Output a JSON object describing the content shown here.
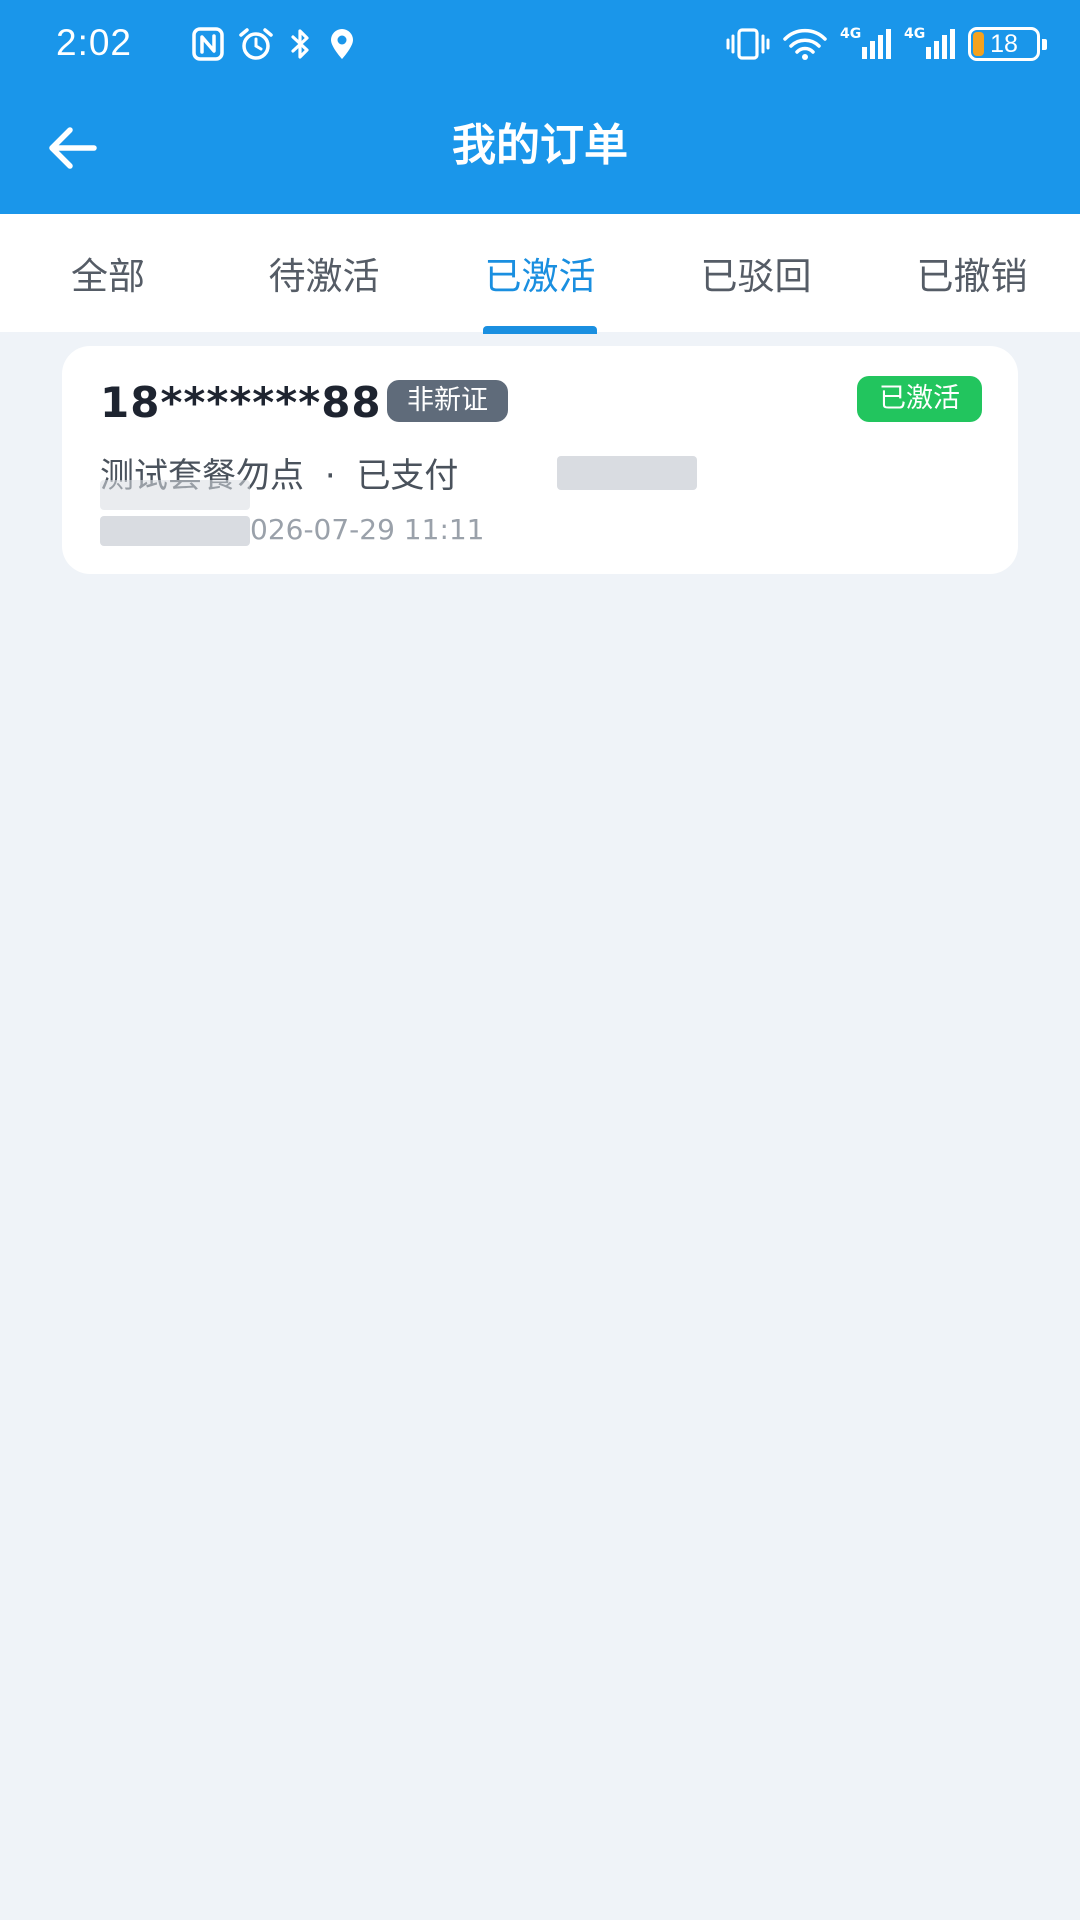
{
  "status_bar": {
    "time": "2:02",
    "battery": "18",
    "battery_fill_percent": 18,
    "network_labels": [
      "4G",
      "4G"
    ],
    "left_icons": [
      "nfc-icon",
      "alarm-icon",
      "bluetooth-icon",
      "location-icon"
    ],
    "right_icons": [
      "vibrate-icon",
      "wifi-icon",
      "signal-icon",
      "signal-icon",
      "battery-icon"
    ]
  },
  "navbar": {
    "title": "我的订单",
    "back_icon": "arrow-left-icon"
  },
  "tabs": [
    {
      "label": "全部",
      "active": false
    },
    {
      "label": "待激活",
      "active": false
    },
    {
      "label": "已激活",
      "active": true
    },
    {
      "label": "已驳回",
      "active": false
    },
    {
      "label": "已撤销",
      "active": false
    }
  ],
  "orders": [
    {
      "phone": "18*******88",
      "cert_tag": "非新证",
      "status": "已激活",
      "package": "测试套餐勿点",
      "separator": "·",
      "payment": "已支付",
      "time": "026-07-29 11:11"
    }
  ],
  "colors": {
    "brand_blue": "#1a96ea",
    "active_tab": "#1a8fe0",
    "status_green": "#22c55e",
    "tag_gray": "#5f6b7a",
    "page_bg": "#eff3f8"
  }
}
